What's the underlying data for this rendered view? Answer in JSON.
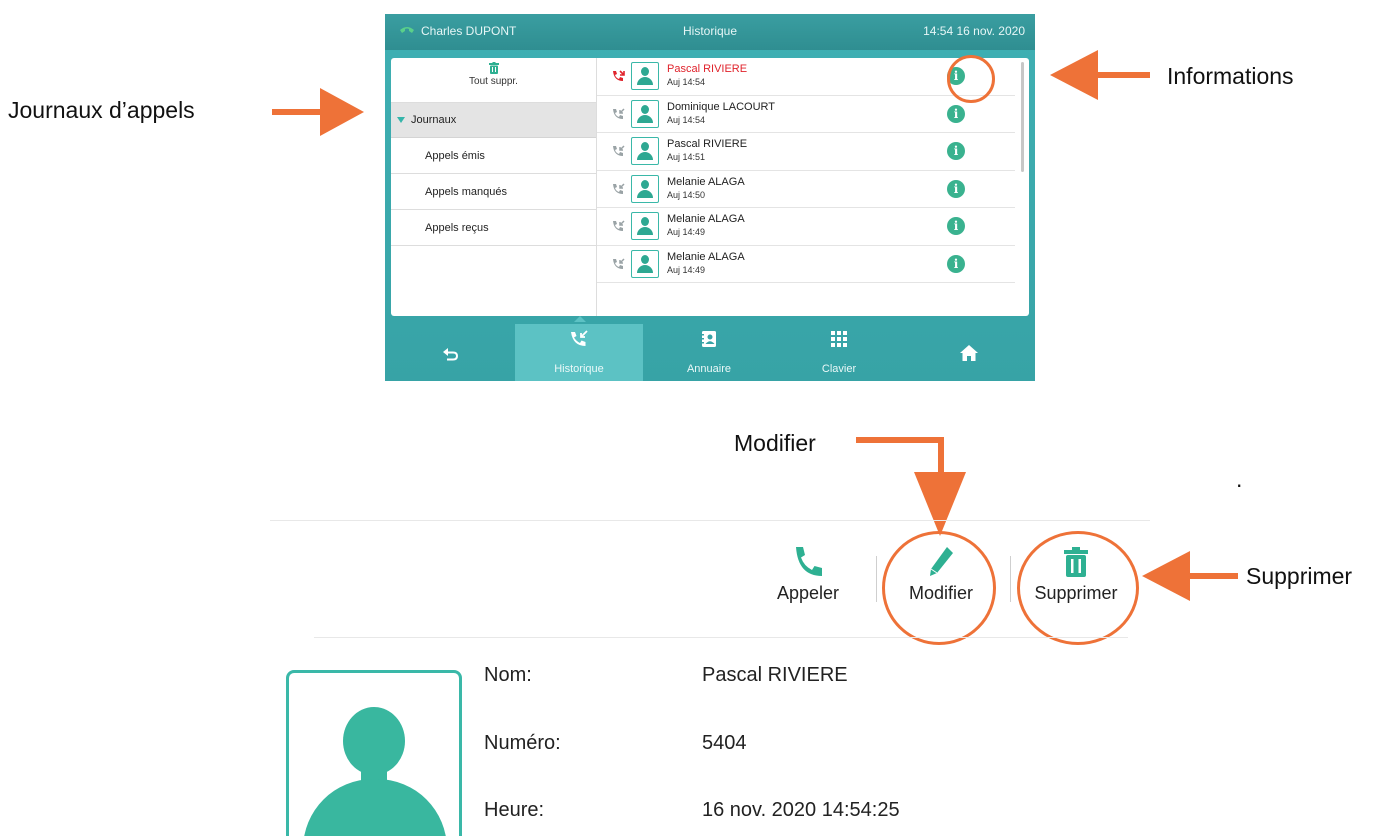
{
  "phone": {
    "user": "Charles DUPONT",
    "title": "Historique",
    "clock": "14:54  16 nov. 2020",
    "sidebar": {
      "delete_all": "Tout suppr.",
      "section": "Journaux",
      "items": [
        "Appels émis",
        "Appels manqués",
        "Appels reçus"
      ]
    },
    "calls": [
      {
        "name": "Pascal RIVIERE",
        "time": "Auj 14:54",
        "missed": true
      },
      {
        "name": "Dominique LACOURT",
        "time": "Auj 14:54",
        "missed": false
      },
      {
        "name": "Pascal RIVIERE",
        "time": "Auj 14:51",
        "missed": false
      },
      {
        "name": "Melanie ALAGA",
        "time": "Auj 14:50",
        "missed": false
      },
      {
        "name": "Melanie ALAGA",
        "time": "Auj 14:49",
        "missed": false
      },
      {
        "name": "Melanie ALAGA",
        "time": "Auj 14:49",
        "missed": false
      }
    ],
    "nav": {
      "historique": "Historique",
      "annuaire": "Annuaire",
      "clavier": "Clavier"
    }
  },
  "annotations": {
    "journaux": "Journaux d’appels",
    "informations": "Informations",
    "modifier": "Modifier",
    "supprimer": "Supprimer",
    "dot": "."
  },
  "detail": {
    "actions": {
      "appeler": "Appeler",
      "modifier": "Modifier",
      "supprimer": "Supprimer"
    },
    "fields": {
      "nom_label": "Nom:",
      "nom_value": "Pascal RIVIERE",
      "numero_label": "Numéro:",
      "numero_value": "5404",
      "heure_label": "Heure:",
      "heure_value": "16 nov. 2020 14:54:25"
    }
  },
  "colors": {
    "accent": "#3ab8a8",
    "annotation": "#ee7238",
    "missed": "#e0232c",
    "phone_bar": "#37a3a6"
  }
}
